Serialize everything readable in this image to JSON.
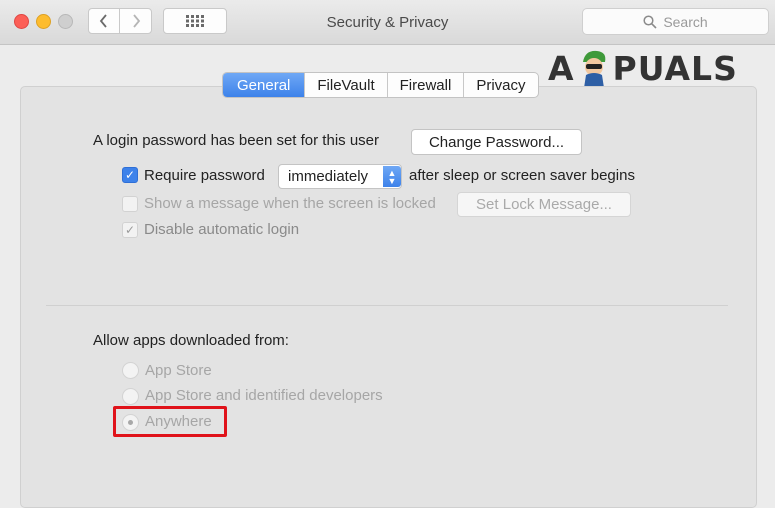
{
  "window": {
    "title": "Security & Privacy"
  },
  "toolbar": {
    "search_placeholder": "Search"
  },
  "watermark": {
    "left": "A",
    "right": "PUALS"
  },
  "tabs": [
    {
      "label": "General",
      "active": true
    },
    {
      "label": "FileVault",
      "active": false
    },
    {
      "label": "Firewall",
      "active": false
    },
    {
      "label": "Privacy",
      "active": false
    }
  ],
  "general": {
    "login_password_text": "A login password has been set for this user",
    "change_password_label": "Change Password...",
    "require_password": {
      "label": "Require password",
      "checked": true,
      "select_value": "immediately",
      "suffix": "after sleep or screen saver begins"
    },
    "show_message": {
      "label": "Show a message when the screen is locked",
      "checked": false,
      "enabled": false,
      "button_label": "Set Lock Message..."
    },
    "disable_auto_login": {
      "label": "Disable automatic login",
      "checked": true,
      "enabled": false
    }
  },
  "allow_apps": {
    "heading": "Allow apps downloaded from:",
    "options": [
      {
        "label": "App Store",
        "selected": false
      },
      {
        "label": "App Store and identified developers",
        "selected": false
      },
      {
        "label": "Anywhere",
        "selected": true
      }
    ]
  },
  "colors": {
    "accent": "#3d82ea",
    "highlight_box": "#e0131a",
    "disabled_text": "#a6a6a6"
  }
}
